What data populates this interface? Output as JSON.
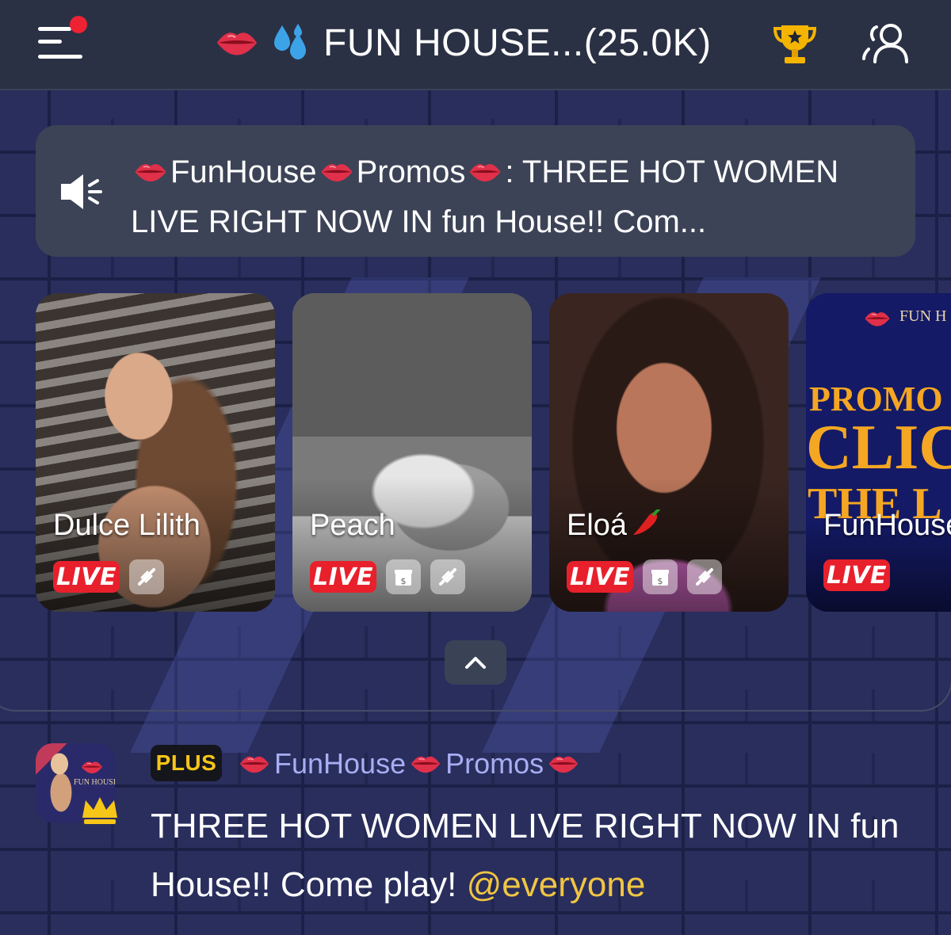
{
  "header": {
    "title": "FUN HOUSE...(25.0K)",
    "icons": [
      "menu-icon",
      "lips-icon",
      "droplets-icon",
      "trophy-icon",
      "members-icon"
    ],
    "menu_badge_color": "#ee2233"
  },
  "announcement": {
    "icon": "speaker-icon",
    "part1": "FunHouse",
    "part2": "Promos",
    "part3": ": THREE HOT WOMEN LIVE RIGHT NOW IN fun House!! Com..."
  },
  "streams": [
    {
      "name": "Dulce Lilith",
      "live_label": "LIVE",
      "badges": [
        "audio-off-icon"
      ]
    },
    {
      "name": "Peach",
      "live_label": "LIVE",
      "badges": [
        "gift-icon",
        "audio-off-icon"
      ]
    },
    {
      "name": "Eloá",
      "live_label": "LIVE",
      "badges": [
        "gift-icon",
        "audio-off-icon"
      ]
    },
    {
      "name": "FunHouse",
      "live_label": "LIVE",
      "badges": [],
      "thumb_text": [
        "FUN H",
        "PROMO",
        "CLIC",
        "THE L"
      ]
    }
  ],
  "collapse_icon": "chevron-up-icon",
  "message": {
    "badge": "PLUS",
    "author_part1": "FunHouse",
    "author_part2": "Promos",
    "text": "THREE HOT WOMEN LIVE RIGHT NOW IN fun House!! Come play! ",
    "mention": "@everyone",
    "avatar_text": "FUN HOUSE"
  },
  "colors": {
    "header_bg": "#2b3144",
    "live_red": "#e8202c",
    "plus_gold": "#f5c518",
    "author_lavender": "#a8aef2",
    "mention_gold": "#f1c542"
  }
}
